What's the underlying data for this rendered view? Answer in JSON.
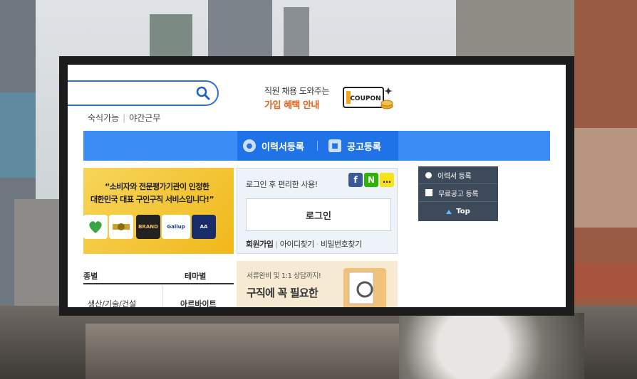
{
  "search": {
    "icon": "search-icon"
  },
  "quick_links": [
    "숙식가능",
    "야간근무"
  ],
  "promo": {
    "line1": "직원 채용 도와주는",
    "line2": "가입 혜택 안내",
    "coupon_label": "COUPON"
  },
  "nav": {
    "resume": "이력서등록",
    "post": "공고등록"
  },
  "banner": {
    "line1": "“소비자와 전문평가기관이 인정한",
    "line2": "대한민국 대표 구인구직 서비스입니다!”",
    "badges": [
      "",
      "",
      "BRAND",
      "Gallup",
      "AA"
    ]
  },
  "login": {
    "prompt": "로그인 후 편리한 사용!",
    "social": [
      "f",
      "N",
      "…"
    ],
    "button": "로그인",
    "join": "회원가입",
    "find_id": "아이디찾기",
    "find_pw": "비밀번호찾기"
  },
  "quick_menu": {
    "resume": "이력서 등록",
    "free_post": "무료공고 등록",
    "top": "Top"
  },
  "category": {
    "left_head": "종별",
    "right_head": "테마별",
    "left_item": "생산/기술/건설",
    "right_item": "아르바이트"
  },
  "lower_banner": {
    "line1": "서류완비 및 1:1 상담까지!",
    "line2": "구직에 꼭 필요한"
  },
  "colors": {
    "accent": "#3b8cf5",
    "accent_dark": "#1f73e6",
    "promo_orange": "#e5631a",
    "quick_menu_bg": "#3c4a5a"
  }
}
